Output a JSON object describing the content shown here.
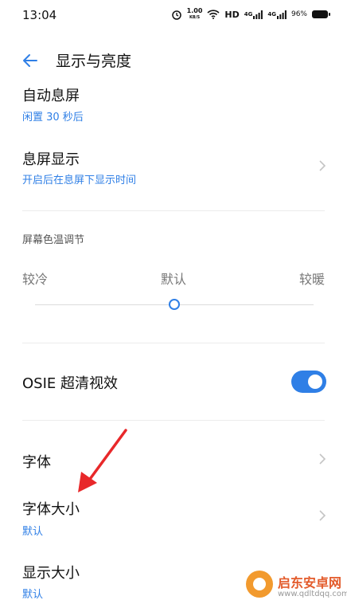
{
  "status_bar": {
    "time": "13:04",
    "speed_value": "1.00",
    "speed_unit": "KB/S",
    "hd_label": "HD",
    "signal1_label": "4G",
    "signal2_label": "4G",
    "battery": "96%"
  },
  "header": {
    "title": "显示与亮度"
  },
  "settings": {
    "auto_sleep": {
      "title": "自动息屏",
      "subtitle": "闲置 30 秒后"
    },
    "aod": {
      "title": "息屏显示",
      "subtitle": "开启后在息屏下显示时间"
    },
    "color_temp": {
      "label": "屏幕色温调节",
      "cold": "较冷",
      "default": "默认",
      "warm": "较暖",
      "value": 0.5
    },
    "osie": {
      "title": "OSIE 超清视效",
      "enabled": true
    },
    "font": {
      "title": "字体"
    },
    "font_size": {
      "title": "字体大小",
      "subtitle": "默认"
    },
    "display_size": {
      "title": "显示大小",
      "subtitle": "默认"
    }
  },
  "colors": {
    "accent": "#2f7fe6",
    "annotation": "#e8282a"
  },
  "watermark": {
    "name": "启东安卓网",
    "url": "www.qdltdqq.com"
  }
}
